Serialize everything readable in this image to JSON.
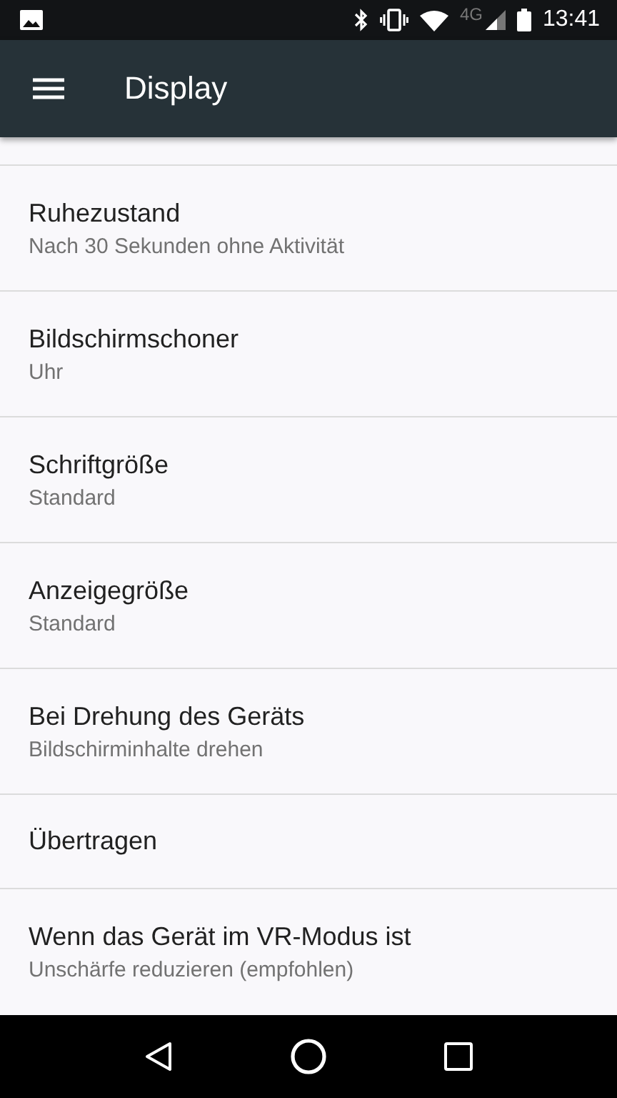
{
  "status_bar": {
    "network": "4G",
    "time": "13:41"
  },
  "app_bar": {
    "title": "Display"
  },
  "settings": [
    {
      "title": "Ruhezustand",
      "summary": "Nach 30 Sekunden ohne Aktivität"
    },
    {
      "title": "Bildschirmschoner",
      "summary": "Uhr"
    },
    {
      "title": "Schriftgröße",
      "summary": "Standard"
    },
    {
      "title": "Anzeigegröße",
      "summary": "Standard"
    },
    {
      "title": "Bei Drehung des Geräts",
      "summary": "Bildschirminhalte drehen"
    },
    {
      "title": "Übertragen"
    },
    {
      "title": "Wenn das Gerät im VR-Modus ist",
      "summary": "Unschärfe reduzieren (empfohlen)"
    }
  ]
}
